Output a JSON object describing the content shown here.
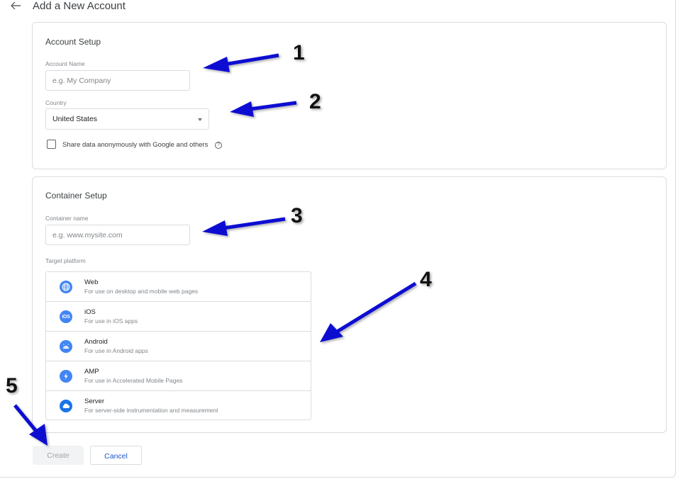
{
  "header": {
    "back_icon": "arrow-back-icon",
    "title": "Add a New Account"
  },
  "account_setup": {
    "title": "Account Setup",
    "account_name": {
      "label": "Account Name",
      "value": "",
      "placeholder": "e.g. My Company"
    },
    "country": {
      "label": "Country",
      "selected": "United States"
    },
    "share_data": {
      "label": "Share data anonymously with Google and others",
      "checked": false,
      "help_icon": "help-circle-icon",
      "help_glyph": "?"
    }
  },
  "container_setup": {
    "title": "Container Setup",
    "container_name": {
      "label": "Container name",
      "value": "",
      "placeholder": "e.g. www.mysite.com"
    },
    "target_platform_label": "Target platform",
    "platforms": [
      {
        "name": "Web",
        "description": "For use on desktop and mobile web pages",
        "icon": "globe-icon"
      },
      {
        "name": "iOS",
        "description": "For use in iOS apps",
        "icon": "ios-icon",
        "glyph": "iOS"
      },
      {
        "name": "Android",
        "description": "For use in Android apps",
        "icon": "android-icon"
      },
      {
        "name": "AMP",
        "description": "For use in Accelerated Mobile Pages",
        "icon": "lightning-bolt-icon"
      },
      {
        "name": "Server",
        "description": "For server-side instrumentation and measurement",
        "icon": "cloud-icon"
      }
    ]
  },
  "actions": {
    "create_label": "Create",
    "cancel_label": "Cancel"
  },
  "annotations": {
    "color": "#0a0ad2",
    "labels": [
      "1",
      "2",
      "3",
      "4",
      "5"
    ]
  }
}
